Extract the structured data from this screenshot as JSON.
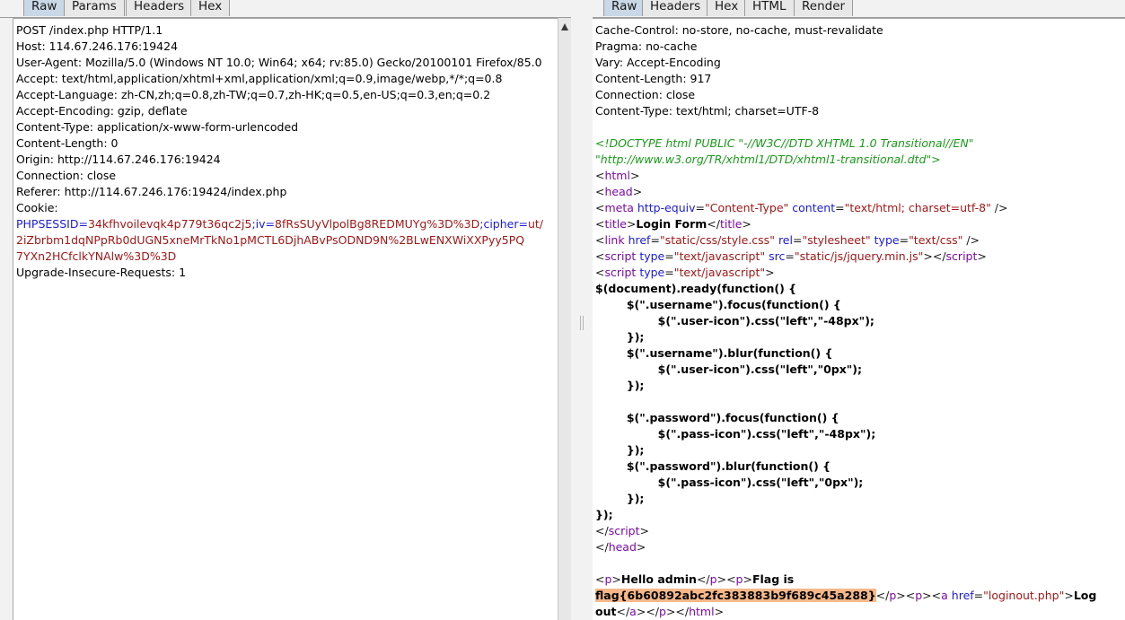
{
  "request": {
    "tabs": [
      {
        "label": "Raw",
        "active": true
      },
      {
        "label": "Params",
        "active": false
      },
      {
        "label": "Headers",
        "active": false
      },
      {
        "label": "Hex",
        "active": false
      }
    ],
    "lines": [
      "POST /index.php HTTP/1.1",
      "Host: 114.67.246.176:19424",
      "User-Agent: Mozilla/5.0 (Windows NT 10.0; Win64; x64; rv:85.0) Gecko/20100101 Firefox/85.0",
      "Accept: text/html,application/xhtml+xml,application/xml;q=0.9,image/webp,*/*;q=0.8",
      "Accept-Language: zh-CN,zh;q=0.8,zh-TW;q=0.7,zh-HK;q=0.5,en-US;q=0.3,en;q=0.2",
      "Accept-Encoding: gzip, deflate",
      "Content-Type: application/x-www-form-urlencoded",
      "Content-Length: 0",
      "Origin: http://114.67.246.176:19424",
      "Connection: close",
      "Referer: http://114.67.246.176:19424/index.php",
      "Cookie:"
    ],
    "cookie": {
      "phpsessid_name": "PHPSESSID",
      "phpsessid_value": "34kfhvoilevqk4p779t36qc2j5",
      "iv_name": "iv",
      "iv_value": "8fRsSUyVlpolBg8REDMUYg%3D%3D",
      "cipher_name": "cipher",
      "cipher_value_1": "ut/",
      "cipher_value_2": "2iZbrbm1dqNPpRb0dUGN5xneMrTkNo1pMCTL6DjhABvPsODND9N%2BLwENXWiXXPyy5PQ",
      "cipher_value_3": "7YXn2HCfclkYNAlw%3D%3D",
      "eq": "=",
      "sep": ";"
    },
    "last_line": "Upgrade-Insecure-Requests: 1"
  },
  "response": {
    "tabs": [
      {
        "label": "Raw",
        "active": true
      },
      {
        "label": "Headers",
        "active": false
      },
      {
        "label": "Hex",
        "active": false
      },
      {
        "label": "HTML",
        "active": false
      },
      {
        "label": "Render",
        "active": false
      }
    ],
    "headers": [
      "Cache-Control: no-store, no-cache, must-revalidate",
      "Pragma: no-cache",
      "Vary: Accept-Encoding",
      "Content-Length: 917",
      "Connection: close",
      "Content-Type: text/html; charset=UTF-8"
    ],
    "doctype_1": "<!DOCTYPE html PUBLIC \"-//W3C//DTD XHTML 1.0 Transitional//EN\"",
    "doctype_2": "\"http://www.w3.org/TR/xhtml1/DTD/xhtml1-transitional.dtd\">",
    "tok": {
      "lt": "<",
      "gt": ">",
      "slash_gt": " />",
      "lt_slash": "</",
      "eq": "=",
      "sp": " ",
      "html": "html",
      "head": "head",
      "meta": "meta",
      "title": "title",
      "link": "link",
      "script": "script",
      "p": "p",
      "a": "a",
      "http_equiv": "http-equiv",
      "content": "content",
      "href": "href",
      "rel": "rel",
      "type": "type",
      "src": "src",
      "v_content_type": "\"Content-Type\"",
      "v_charset": "\"text/html; charset=utf-8\"",
      "v_style_href": "\"static/css/style.css\"",
      "v_stylesheet": "\"stylesheet\"",
      "v_text_css": "\"text/css\"",
      "v_text_js": "\"text/javascript\"",
      "v_jquery_src": "\"static/js/jquery.min.js\"",
      "v_loginout": "\"loginout.php\"",
      "title_text": "Login Form",
      "hello": "Hello admin",
      "flag_is": "Flag is",
      "flag": "flag{6b60892abc2fc383883b9f689c45a288}",
      "log": "Log",
      "out": "out"
    },
    "js_lines": [
      "$(document).ready(function() {",
      "        $(\".username\").focus(function() {",
      "                $(\".user-icon\").css(\"left\",\"-48px\");",
      "        });",
      "        $(\".username\").blur(function() {",
      "                $(\".user-icon\").css(\"left\",\"0px\");",
      "        });",
      "",
      "        $(\".password\").focus(function() {",
      "                $(\".pass-icon\").css(\"left\",\"-48px\");",
      "        });",
      "        $(\".password\").blur(function() {",
      "                $(\".pass-icon\").css(\"left\",\"0px\");",
      "        });",
      "});"
    ]
  }
}
